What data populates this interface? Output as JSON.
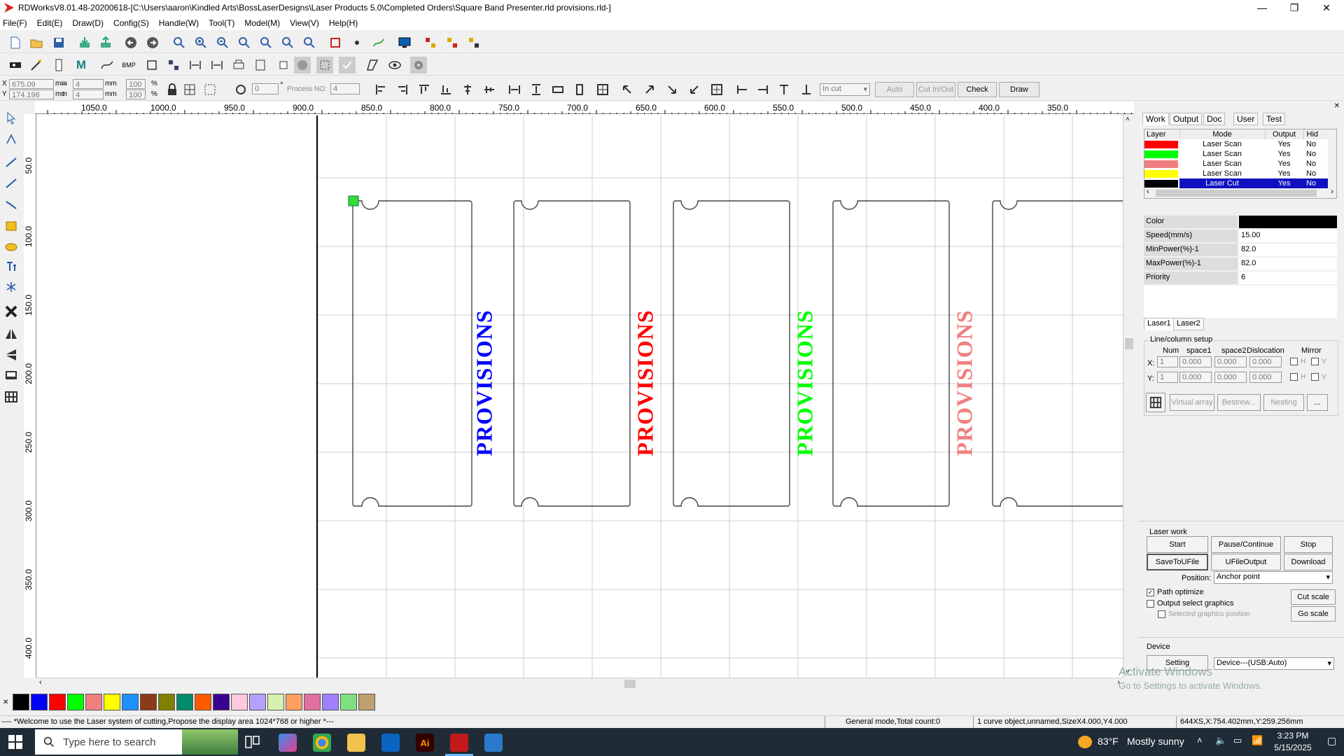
{
  "window": {
    "title": "RDWorksV8.01.48-20200618-[C:\\Users\\aaron\\Kindled Arts\\BossLaserDesigns\\Laser Products 5.0\\Completed Orders\\Square Band Presenter.rld provisions.rld-]",
    "minimize": "—",
    "maximize": "❐",
    "close": "✕"
  },
  "menu": [
    "File(F)",
    "Edit(E)",
    "Draw(D)",
    "Config(S)",
    "Handle(W)",
    "Tool(T)",
    "Model(M)",
    "View(V)",
    "Help(H)"
  ],
  "toolbar3": {
    "x_label": "X",
    "x_value": "675.09",
    "y_label": "Y",
    "y_value": "174.196",
    "unit_mm": "mm",
    "w_value": "4",
    "h_value": "4",
    "pct_w": "100",
    "pct_h": "100",
    "pct": "%",
    "angle": "0",
    "degree": "°",
    "process_no_label": "Process NO:",
    "process_no": "4",
    "incut_select": "In cut",
    "auto_btn": "Auto",
    "cutinout_btn": "Cut In/Out",
    "check_btn": "Check",
    "draw_btn": "Draw"
  },
  "ruler_top": [
    "1050.0",
    "1000.0",
    "950.0",
    "900.0",
    "850.0",
    "800.0",
    "750.0",
    "700.0",
    "650.0",
    "600.0",
    "550.0",
    "500.0",
    "450.0",
    "400.0",
    "350.0"
  ],
  "ruler_left": [
    "50.0",
    "100.0",
    "150.0",
    "200.0",
    "250.0",
    "300.0",
    "350.0",
    "400.0"
  ],
  "canvas_texts": [
    {
      "text": "PROVISIONS",
      "color": "#0000ff"
    },
    {
      "text": "PROVISIONS",
      "color": "#ff0000"
    },
    {
      "text": "PROVISIONS",
      "color": "#00ff00"
    },
    {
      "text": "PROVISIONS",
      "color": "#f08080"
    }
  ],
  "right_panel": {
    "tabs": [
      "Work",
      "Output",
      "Doc",
      "User",
      "Test"
    ],
    "layer_headers": [
      "Layer",
      "Mode",
      "Output",
      "Hid"
    ],
    "layers": [
      {
        "color": "#ff0000",
        "mode": "Laser Scan",
        "output": "Yes",
        "hide": "No"
      },
      {
        "color": "#00ff00",
        "mode": "Laser Scan",
        "output": "Yes",
        "hide": "No"
      },
      {
        "color": "#f08080",
        "mode": "Laser Scan",
        "output": "Yes",
        "hide": "No"
      },
      {
        "color": "#ffff00",
        "mode": "Laser Scan",
        "output": "Yes",
        "hide": "No"
      },
      {
        "color": "#000000",
        "mode": "Laser Cut",
        "output": "Yes",
        "hide": "No"
      }
    ],
    "props": [
      {
        "label": "Color",
        "value": ""
      },
      {
        "label": "Speed(mm/s)",
        "value": "15.00"
      },
      {
        "label": "MinPower(%)-1",
        "value": "82.0"
      },
      {
        "label": "MaxPower(%)-1",
        "value": "82.0"
      },
      {
        "label": "Priority",
        "value": "6"
      }
    ],
    "laser_tabs": [
      "Laser1",
      "Laser2"
    ],
    "linecol": {
      "title": "Line/column setup",
      "headers": [
        "Num",
        "space1",
        "space2",
        "Dislocation",
        "Mirror"
      ],
      "x_label": "X:",
      "y_label": "Y:",
      "x_vals": [
        "1",
        "0.000",
        "0.000",
        "0.000"
      ],
      "y_vals": [
        "1",
        "0.000",
        "0.000",
        "0.000"
      ],
      "h": "H",
      "v": "V",
      "virtual_array": "Virtual array",
      "bestrew": "Bestrew...",
      "nesting": "Nesting",
      "more": "..."
    },
    "laserwork": {
      "title": "Laser work",
      "start": "Start",
      "pause": "Pause/Continue",
      "stop": "Stop",
      "save_u": "SaveToUFile",
      "ufile_out": "UFileOutput",
      "download": "Download",
      "position_label": "Position:",
      "position_value": "Anchor point",
      "path_optimize": "Path optimize",
      "output_select": "Output select graphics",
      "selected_pos": "Selected graphics position",
      "cut_scale": "Cut scale",
      "go_scale": "Go scale"
    },
    "device": {
      "title": "Device",
      "setting": "Setting",
      "device_value": "Device---(USB:Auto)"
    }
  },
  "palette": [
    "#000000",
    "#0000ff",
    "#ff0000",
    "#00ff00",
    "#f08080",
    "#ffff00",
    "#1e90ff",
    "#8b3a1a",
    "#808000",
    "#008b6b",
    "#ff5a00",
    "#3a0090",
    "#ffc8dc",
    "#b4a0ff",
    "#d8f0b0",
    "#ffa060",
    "#e070a0",
    "#a080ff",
    "#80e080",
    "#c0a070"
  ],
  "status": {
    "welcome": "---- *Welcome to use the Laser system of cutting,Propose the display area 1024*768 or higher *---",
    "mode": "General mode,Total count:0",
    "selection": "1 curve object,unnamed,SizeX4.000,Y4.000",
    "coords": "644XS,X:754.402mm,Y:259.256mm"
  },
  "watermark": {
    "line1": "Activate Windows",
    "line2": "Go to Settings to activate Windows."
  },
  "taskbar": {
    "search_placeholder": "Type here to search",
    "weather_temp": "83°F",
    "weather_desc": "Mostly sunny",
    "time": "3:23 PM",
    "date": "5/15/2025"
  }
}
